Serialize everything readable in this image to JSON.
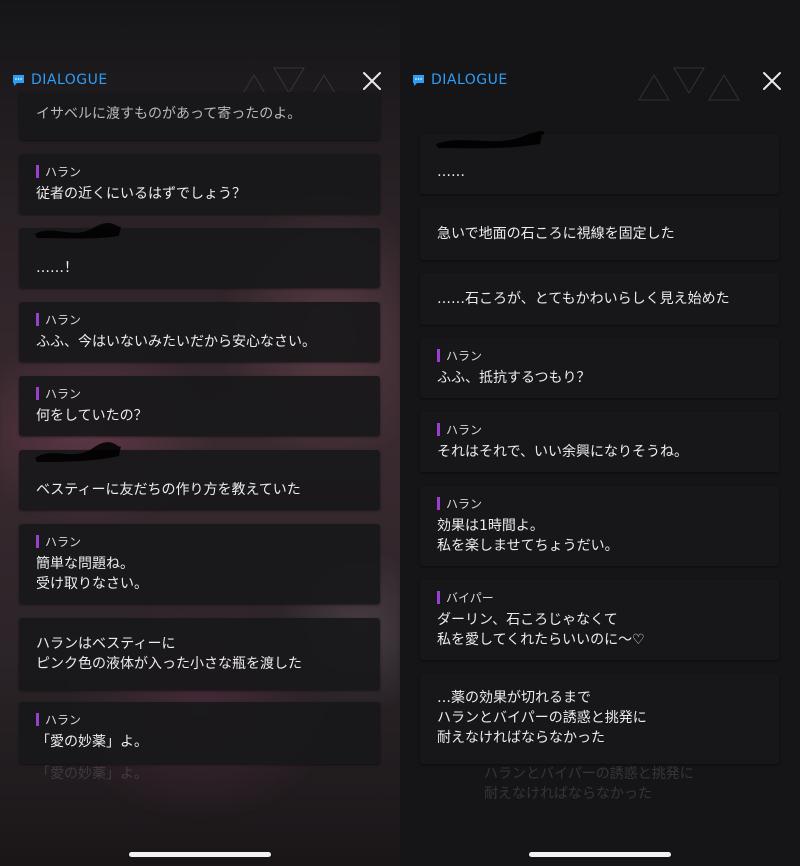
{
  "colors": {
    "accent": "#2e9df5",
    "speaker_bar": "#9a3fd0",
    "card_bg": "#18181a"
  },
  "left": {
    "header": {
      "title": "DIALOGUE"
    },
    "cards": [
      {
        "speaker": "",
        "text": "イサベルに渡すものがあって寄ったのよ。"
      },
      {
        "speaker": "ハラン",
        "text": "従者の近くにいるはずでしょう？"
      },
      {
        "speaker": "",
        "text": "……！"
      },
      {
        "speaker": "ハラン",
        "text": "ふふ、今はいないみたいだから安心なさい。"
      },
      {
        "speaker": "ハラン",
        "text": "何をしていたの？"
      },
      {
        "speaker": "",
        "text": "ベスティーに友だちの作り方を教えていた"
      },
      {
        "speaker": "ハラン",
        "text": "簡単な問題ね。\n受け取りなさい。"
      },
      {
        "speaker": "",
        "text": "ハランはベスティーに\nピンク色の液体が入った小さな瓶を渡した"
      },
      {
        "speaker": "ハラン",
        "text": "「愛の妙薬」よ。"
      }
    ],
    "ghost_text": "「愛の妙薬」よ。"
  },
  "right": {
    "header": {
      "title": "DIALOGUE"
    },
    "cards": [
      {
        "speaker": "",
        "text": "……"
      },
      {
        "speaker": "",
        "text": "急いで地面の石ころに視線を固定した"
      },
      {
        "speaker": "",
        "text": "……石ころが、とてもかわいらしく見え始めた"
      },
      {
        "speaker": "ハラン",
        "text": "ふふ、抵抗するつもり？"
      },
      {
        "speaker": "ハラン",
        "text": "それはそれで、いい余興になりそうね。"
      },
      {
        "speaker": "ハラン",
        "text": "効果は1時間よ。\n私を楽しませてちょうだい。"
      },
      {
        "speaker": "バイパー",
        "text": "ダーリン、石ころじゃなくて\n私を愛してくれたらいいのに～♡"
      },
      {
        "speaker": "",
        "text": "…薬の効果が切れるまで\nハランとバイパーの誘惑と挑発に\n耐えなければならなかった"
      }
    ],
    "ghost_text": "ハランとバイパーの誘惑と挑発に\n耐えなければならなかった"
  },
  "icons": {
    "chat": "chat-bubble-icon",
    "close": "close-icon"
  }
}
